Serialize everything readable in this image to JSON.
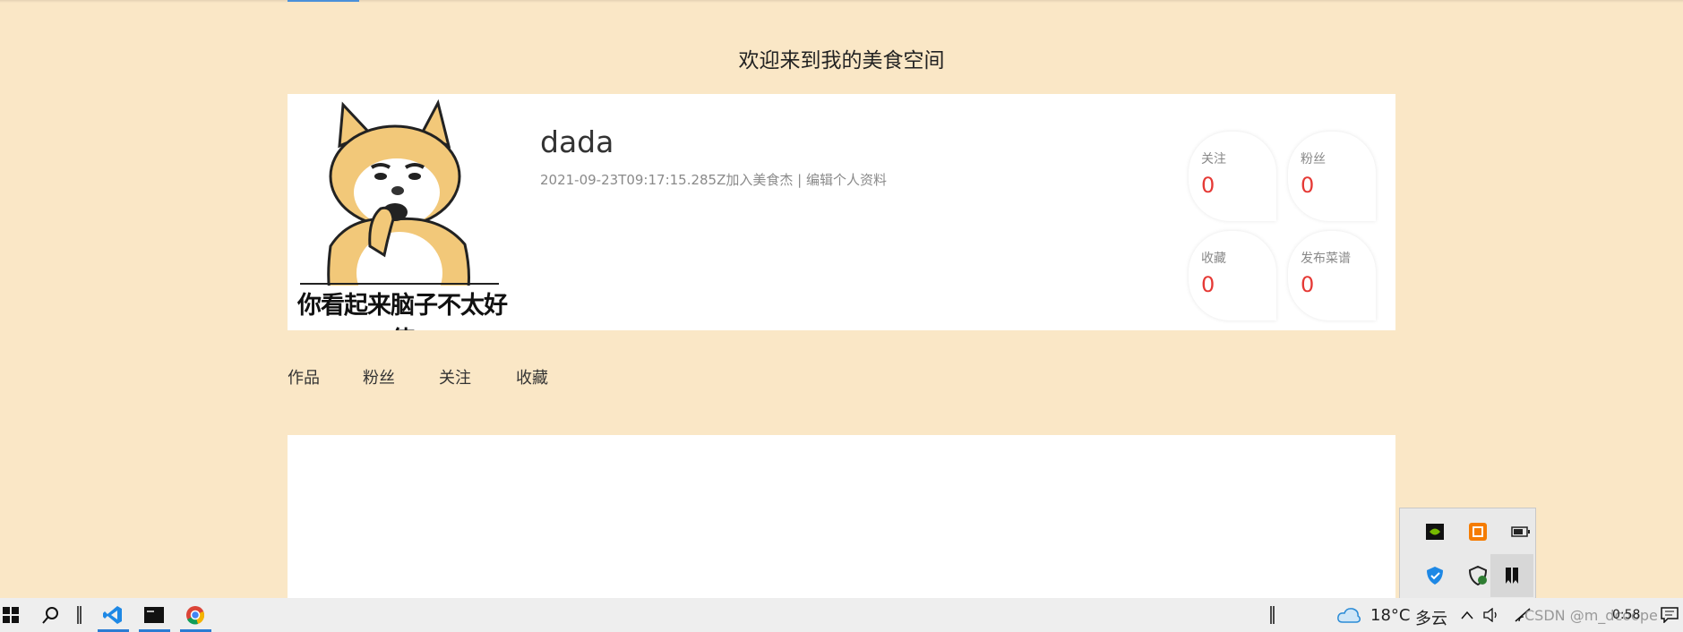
{
  "page": {
    "welcome": "欢迎来到我的美食空间"
  },
  "avatar": {
    "caption": "你看起来脑子不太好使"
  },
  "user": {
    "name": "dada",
    "joined": "2021-09-23T09:17:15.285Z加入美食杰",
    "separator": " | ",
    "edit_link": "编辑个人资料"
  },
  "stats": [
    {
      "label": "关注",
      "value": "0"
    },
    {
      "label": "粉丝",
      "value": "0"
    },
    {
      "label": "收藏",
      "value": "0"
    },
    {
      "label": "发布菜谱",
      "value": "0"
    }
  ],
  "tabs": [
    "作品",
    "粉丝",
    "关注",
    "收藏"
  ],
  "taskbar": {
    "weather_temp": "18°C",
    "weather_text": "多云",
    "time": "0:58",
    "watermark": "CSDN @m_dcoope"
  },
  "colors": {
    "background": "#fae7c6",
    "stat_value": "#e53935",
    "accent": "#2b7cd3"
  }
}
